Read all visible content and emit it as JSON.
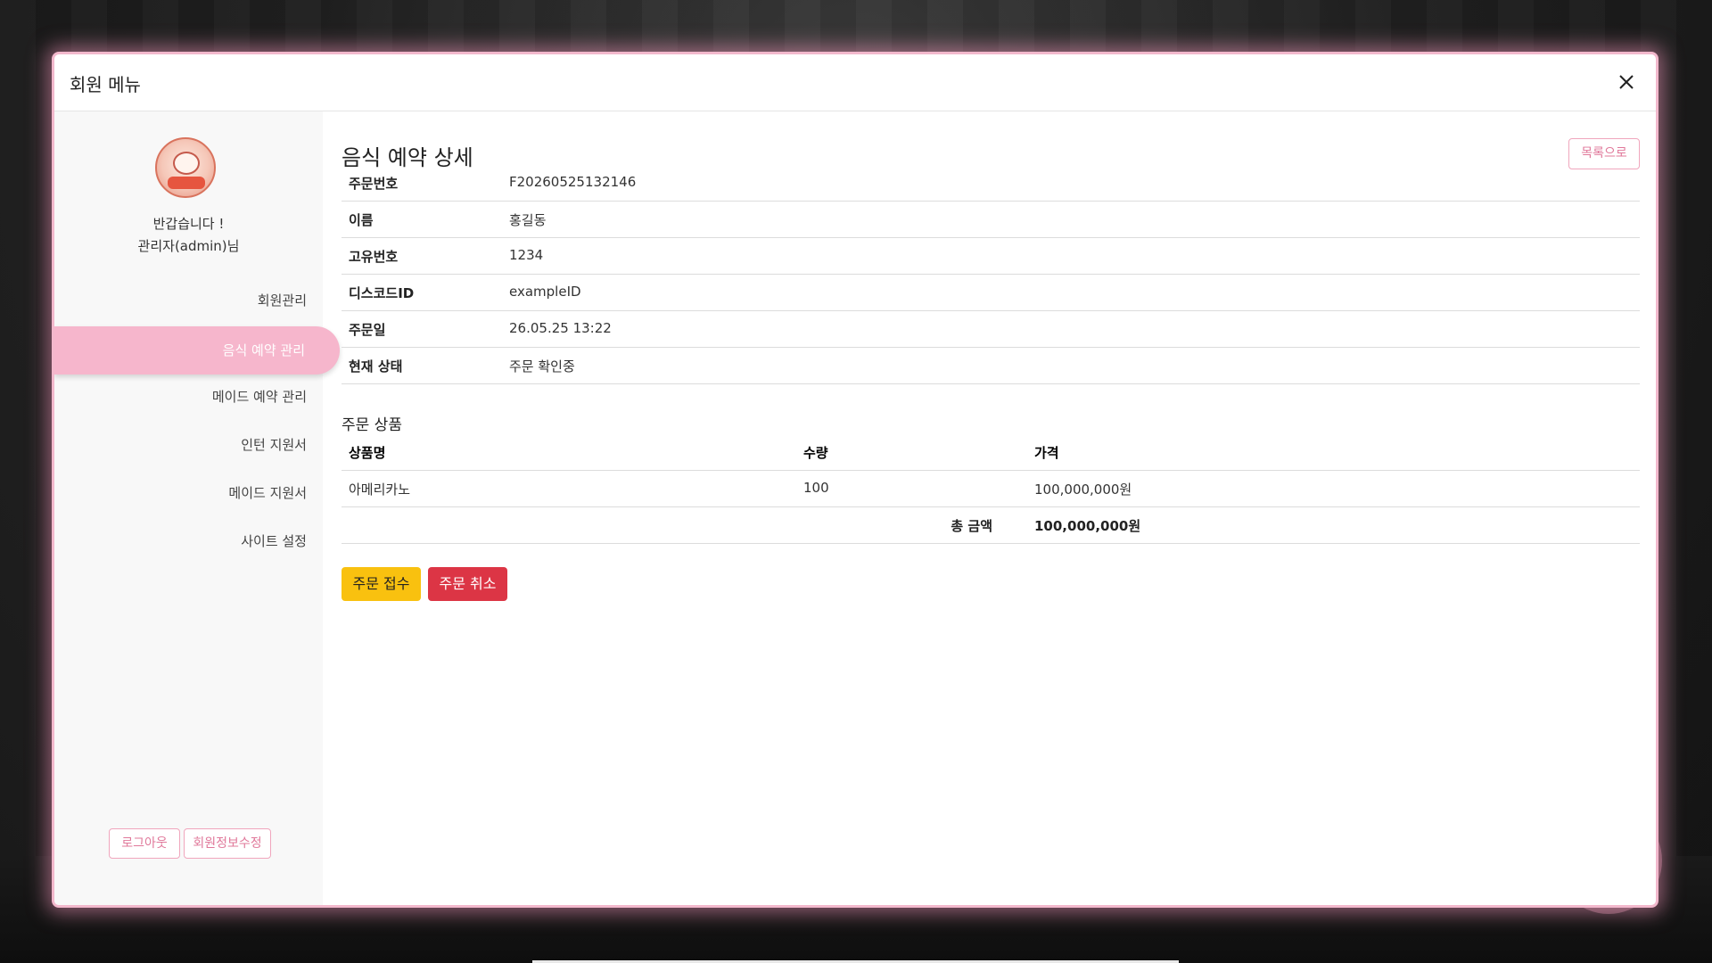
{
  "modal": {
    "title": "회원 메뉴",
    "close_icon": "close-icon"
  },
  "sidebar": {
    "avatar_icon": "mascot-logo-icon",
    "greeting_line1": "반갑습니다 !",
    "greeting_line2": "관리자(admin)님",
    "items": [
      {
        "label": "회원관리",
        "active": false
      },
      {
        "label": "음식 예약 관리",
        "active": true
      },
      {
        "label": "메이드 예약 관리",
        "active": false
      },
      {
        "label": "인턴 지원서",
        "active": false
      },
      {
        "label": "메이드 지원서",
        "active": false
      },
      {
        "label": "사이트 설정",
        "active": false
      }
    ],
    "logout_label": "로그아웃",
    "edit_profile_label": "회원정보수정"
  },
  "main": {
    "page_title": "음식 예약 상세",
    "list_button": "목록으로",
    "details": [
      {
        "key": "주문번호",
        "value": "F20260525132146"
      },
      {
        "key": "이름",
        "value": "홍길동"
      },
      {
        "key": "고유번호",
        "value": "1234"
      },
      {
        "key": "디스코드ID",
        "value": "exampleID"
      },
      {
        "key": "주문일",
        "value": "26.05.25 13:22"
      },
      {
        "key": "현재 상태",
        "value": "주문 확인중"
      }
    ],
    "items_section_title": "주문 상품",
    "items_table": {
      "headers": [
        "상품명",
        "수량",
        "가격"
      ],
      "rows": [
        {
          "name": "아메리카노",
          "qty": "100",
          "price": "100,000,000원"
        }
      ],
      "total_label": "총 금액",
      "total_value": "100,000,000원"
    },
    "accept_button": "주문 접수",
    "cancel_button": "주문 취소"
  },
  "colors": {
    "accent_pink": "#f6b6cc",
    "accept_yellow": "#f9c10f",
    "cancel_red": "#dc3545"
  }
}
